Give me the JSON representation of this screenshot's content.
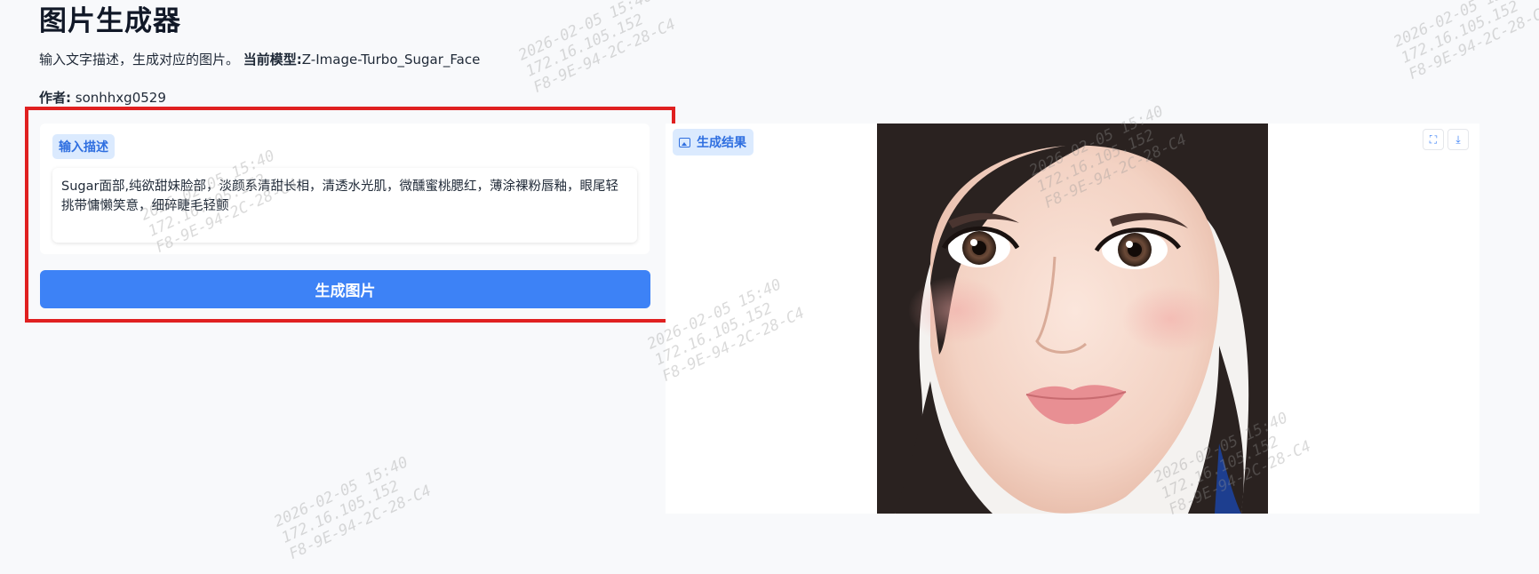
{
  "header": {
    "title": "图片生成器",
    "description": "输入文字描述，生成对应的图片。",
    "model_label": "当前模型:",
    "model_value": "Z-Image-Turbo_Sugar_Face",
    "author_label": "作者:",
    "author_value": "sonhhxg0529"
  },
  "input": {
    "label": "输入描述",
    "prompt_text": "Sugar面部,纯欲甜妹脸部，淡颜系清甜长相，清透水光肌，微醺蜜桃腮红，薄涂裸粉唇釉，眼尾轻挑带慵懒笑意，细碎睫毛轻颤"
  },
  "generate_button": {
    "label": "生成图片"
  },
  "result": {
    "label": "生成结果",
    "fullscreen_icon": "⛶",
    "download_icon": "⤓"
  },
  "watermark": {
    "line1": "2026-02-05 15:40",
    "line2": "172.16.105.152",
    "line3": "F8-9E-94-2C-28-C4"
  },
  "colors": {
    "accent": "#3d82f6",
    "highlight_border": "#e02020",
    "label_bg": "#dbeafe"
  }
}
